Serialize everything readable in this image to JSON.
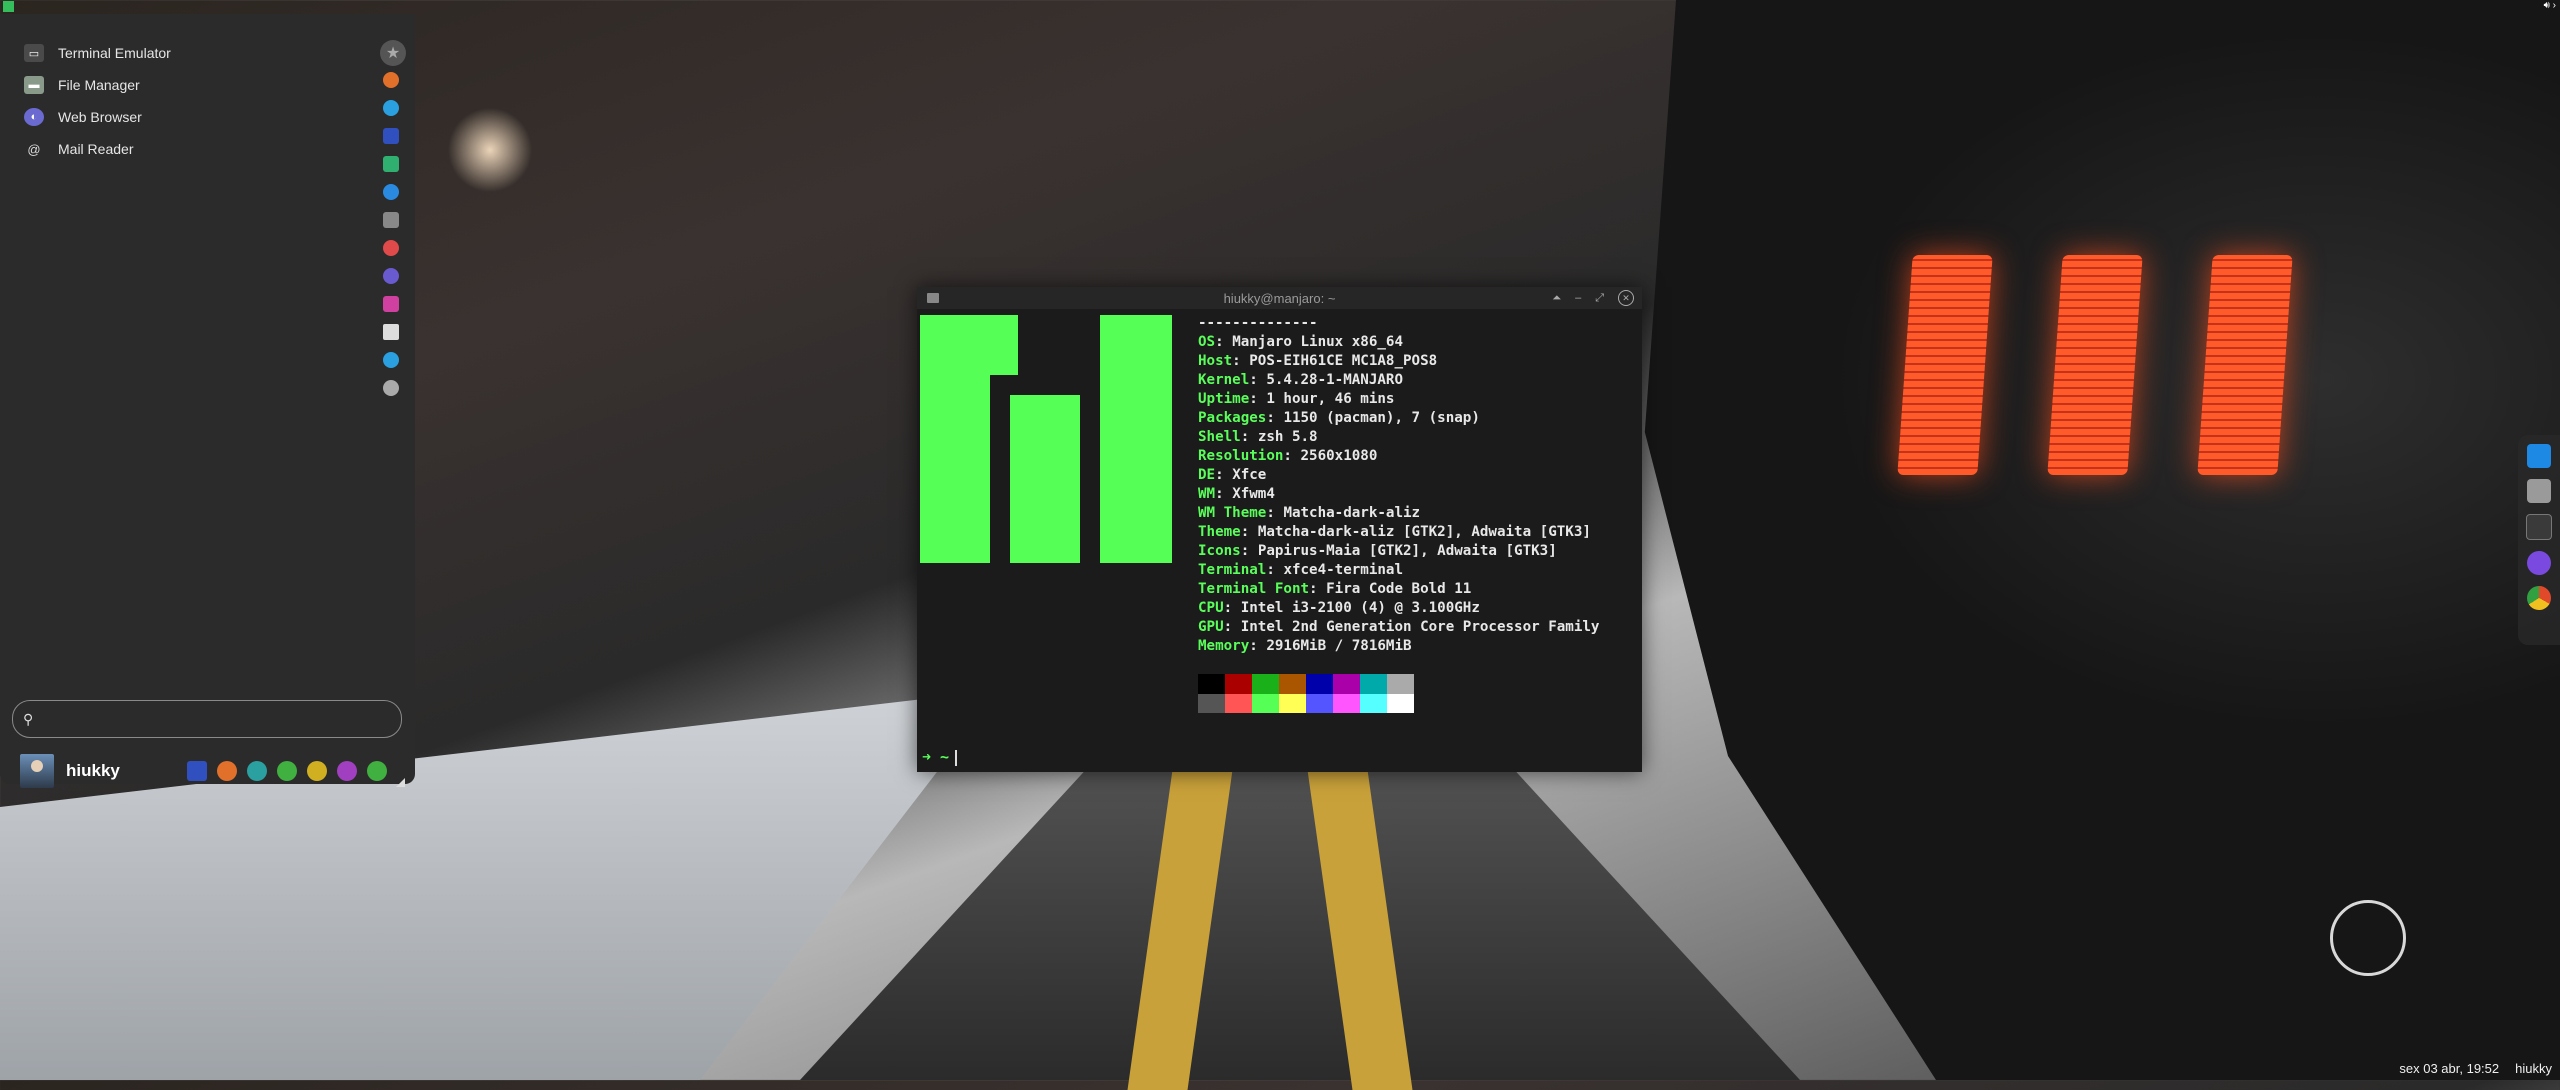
{
  "top_panel": {
    "volume_icon": "volume-icon",
    "more_icon": "chevron-right-icon"
  },
  "app_menu": {
    "favorites": [
      {
        "label": "Terminal Emulator",
        "icon": "terminal-icon",
        "color": "#4a4a4a"
      },
      {
        "label": "File Manager",
        "icon": "file-manager-icon",
        "color": "#8a9a8a"
      },
      {
        "label": "Web Browser",
        "icon": "web-browser-icon",
        "color": "#6a6ad0"
      },
      {
        "label": "Mail Reader",
        "icon": "at-icon",
        "color": "#2b2b2b"
      }
    ],
    "categories": [
      "#555555",
      "#e0702a",
      "#2aa0e0",
      "#3050c0",
      "#30b070",
      "#2a8ae0",
      "#888888",
      "#e04a4a",
      "#6a5ad0",
      "#d040a0",
      "#dddddd",
      "#2aa0e0",
      "#aaaaaa"
    ],
    "search": {
      "placeholder": "",
      "value": ""
    },
    "user": {
      "name": "hiukky"
    },
    "quick_actions": [
      "#3050c0",
      "#e0702a",
      "#2aa0a0",
      "#40b040",
      "#d0b020",
      "#a040c0",
      "#40b040"
    ]
  },
  "terminal": {
    "title": "hiukky@manjaro: ~",
    "separator": "--------------",
    "info": [
      {
        "k": "OS",
        "v": "Manjaro Linux x86_64"
      },
      {
        "k": "Host",
        "v": "POS-EIH61CE MC1A8_POS8"
      },
      {
        "k": "Kernel",
        "v": "5.4.28-1-MANJARO"
      },
      {
        "k": "Uptime",
        "v": "1 hour, 46 mins"
      },
      {
        "k": "Packages",
        "v": "1150 (pacman), 7 (snap)"
      },
      {
        "k": "Shell",
        "v": "zsh 5.8"
      },
      {
        "k": "Resolution",
        "v": "2560x1080"
      },
      {
        "k": "DE",
        "v": "Xfce"
      },
      {
        "k": "WM",
        "v": "Xfwm4"
      },
      {
        "k": "WM Theme",
        "v": "Matcha-dark-aliz"
      },
      {
        "k": "Theme",
        "v": "Matcha-dark-aliz [GTK2], Adwaita [GTK3]"
      },
      {
        "k": "Icons",
        "v": "Papirus-Maia [GTK2], Adwaita [GTK3]"
      },
      {
        "k": "Terminal",
        "v": "xfce4-terminal"
      },
      {
        "k": "Terminal Font",
        "v": "Fira Code Bold 11"
      },
      {
        "k": "CPU",
        "v": "Intel i3-2100 (4) @ 3.100GHz"
      },
      {
        "k": "GPU",
        "v": "Intel 2nd Generation Core Processor Family"
      },
      {
        "k": "Memory",
        "v": "2916MiB / 7816MiB"
      }
    ],
    "palette": [
      "#000000",
      "#aa0000",
      "#1ab01a",
      "#aa5500",
      "#0000aa",
      "#aa00aa",
      "#00aaaa",
      "#aaaaaa",
      "#555555",
      "#ff5555",
      "#55ff55",
      "#ffff55",
      "#5555ff",
      "#ff55ff",
      "#55ffff",
      "#ffffff"
    ],
    "prompt": "➜  ~",
    "logo_color": "#55ff55"
  },
  "dock": [
    "#1e88e5",
    "#9a9a9a",
    "#3a3a3a",
    "#7a4ae0",
    "#e04a2a"
  ],
  "clock": {
    "datetime": "sex 03 abr, 19:52",
    "user": "hiukky"
  }
}
